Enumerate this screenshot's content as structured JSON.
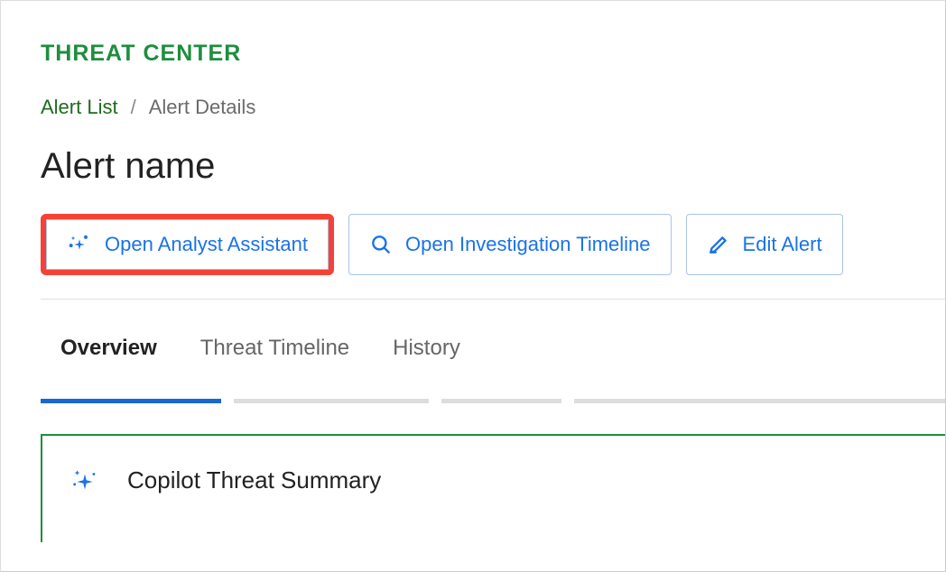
{
  "header": {
    "section_label": "THREAT CENTER"
  },
  "breadcrumb": {
    "parent": "Alert List",
    "separator": "/",
    "current": "Alert Details"
  },
  "title": "Alert name",
  "actions": {
    "open_assistant": "Open Analyst Assistant",
    "open_timeline": "Open Investigation Timeline",
    "edit_alert": "Edit Alert"
  },
  "tabs": {
    "overview": "Overview",
    "threat_timeline": "Threat Timeline",
    "history": "History"
  },
  "summary": {
    "title": "Copilot Threat Summary"
  },
  "colors": {
    "brand_green": "#1e8e3e",
    "link_blue": "#1a73e8",
    "highlight_red": "#f44336"
  }
}
